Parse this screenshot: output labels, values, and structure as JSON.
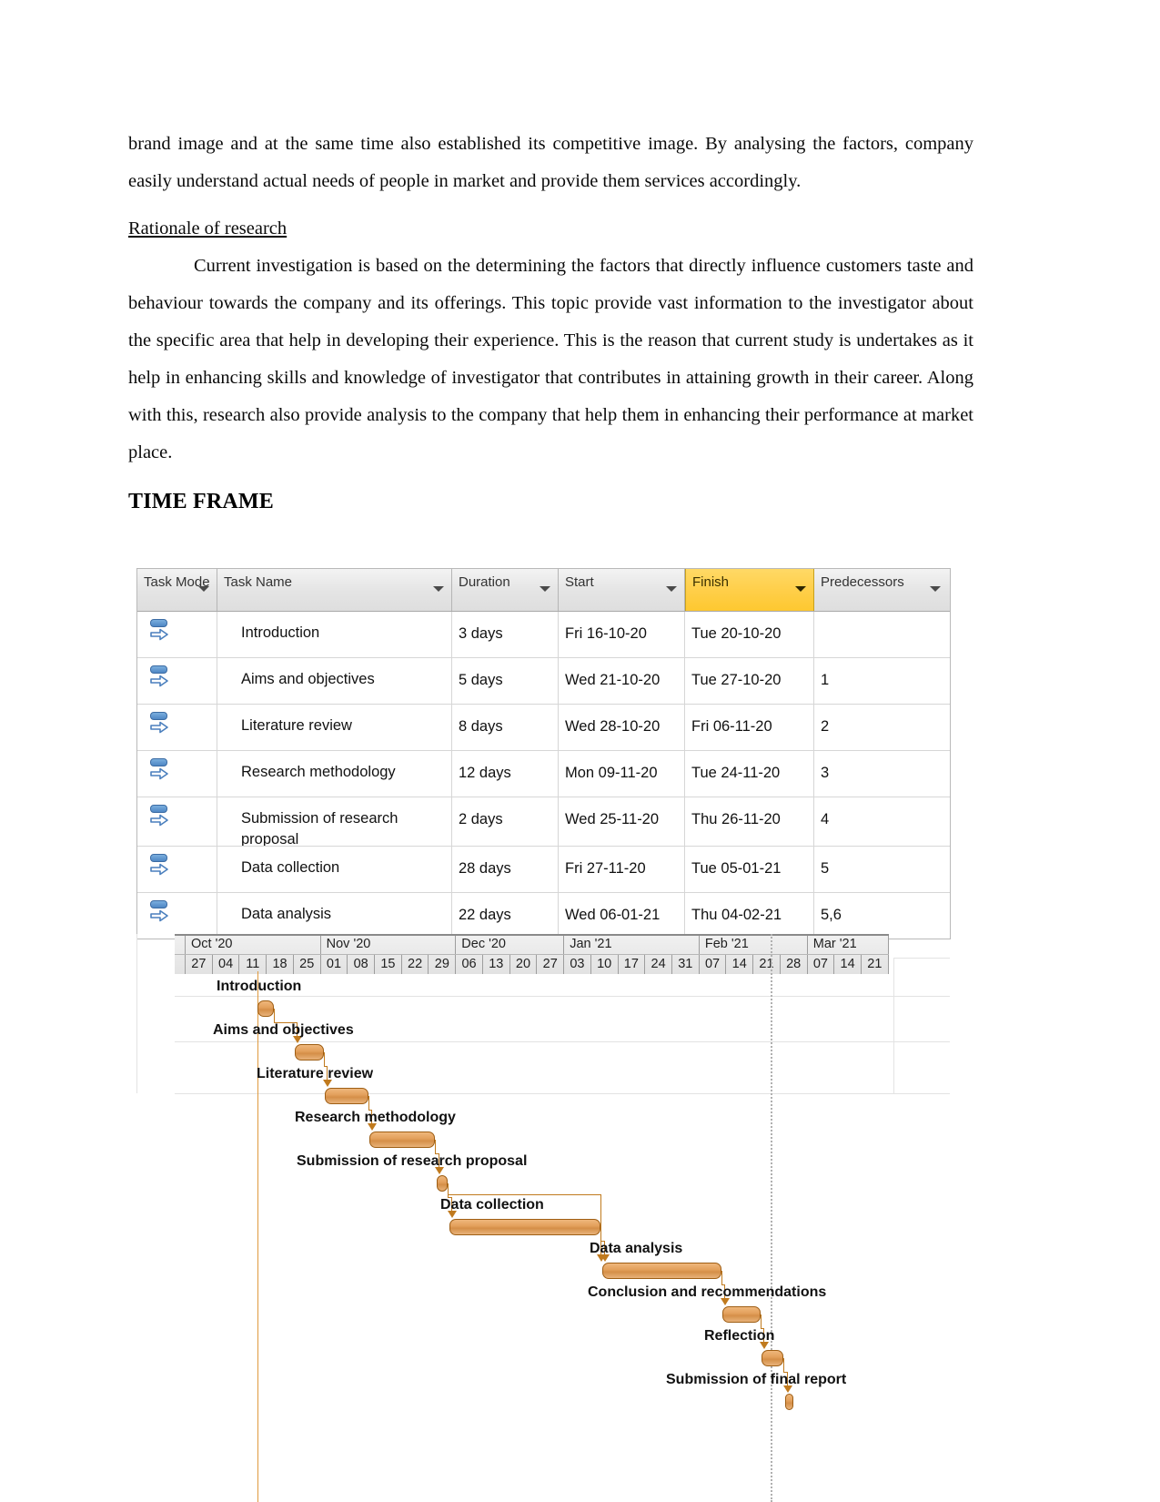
{
  "document": {
    "paragraph_1": "brand image and at the same time also established its competitive image. By analysing the factors, company easily understand actual needs of people in market and provide them services accordingly.",
    "heading_rationale": "Rationale of research",
    "paragraph_2": "Current investigation is based on the determining the factors that directly influence customers taste and behaviour towards the company and its offerings. This topic provide vast information to the investigator about the specific area that help in developing their experience. This is the reason that current study is undertakes as it help in enhancing skills and knowledge of investigator that contributes in attaining growth in their career. Along with this, research also provide analysis to the company that help them in enhancing their performance at market place.",
    "heading_time_frame": "TIME FRAME"
  },
  "project_table": {
    "headers": {
      "task_mode": "Task Mode",
      "task_name": "Task Name",
      "duration": "Duration",
      "start": "Start",
      "finish": "Finish",
      "predecessors": "Predecessors"
    },
    "highlight_color": "#ffcf4a",
    "rows": [
      {
        "mode_icon": "auto-schedule-icon",
        "name": "Introduction",
        "duration": "3 days",
        "start": "Fri 16-10-20",
        "finish": "Tue 20-10-20",
        "predecessors": ""
      },
      {
        "mode_icon": "auto-schedule-icon",
        "name": "Aims and objectives",
        "duration": "5 days",
        "start": "Wed 21-10-20",
        "finish": "Tue 27-10-20",
        "predecessors": "1"
      },
      {
        "mode_icon": "auto-schedule-icon",
        "name": "Literature review",
        "duration": "8 days",
        "start": "Wed 28-10-20",
        "finish": "Fri 06-11-20",
        "predecessors": "2"
      },
      {
        "mode_icon": "auto-schedule-icon",
        "name": "Research methodology",
        "duration": "12 days",
        "start": "Mon 09-11-20",
        "finish": "Tue 24-11-20",
        "predecessors": "3"
      },
      {
        "mode_icon": "auto-schedule-icon",
        "name": "Submission of research proposal",
        "duration": "2 days",
        "start": "Wed 25-11-20",
        "finish": "Thu 26-11-20",
        "predecessors": "4"
      },
      {
        "mode_icon": "auto-schedule-icon",
        "name": "Data collection",
        "duration": "28 days",
        "start": "Fri 27-11-20",
        "finish": "Tue 05-01-21",
        "predecessors": "5"
      },
      {
        "mode_icon": "auto-schedule-icon",
        "name": "Data analysis",
        "duration": "22 days",
        "start": "Wed 06-01-21",
        "finish": "Thu 04-02-21",
        "predecessors": "5,6"
      }
    ]
  },
  "chart_data": {
    "type": "bar",
    "title": "TIME FRAME",
    "subtype": "gantt",
    "xlabel": "",
    "ylabel": "",
    "grid": true,
    "legend": "none",
    "timescale": {
      "months": [
        "Oct '20",
        "Nov '20",
        "Dec '20",
        "Jan '21",
        "Feb '21",
        "Mar '21"
      ],
      "month_week_counts": [
        5,
        5,
        4,
        5,
        4,
        3
      ],
      "weeks": [
        "27",
        "04",
        "11",
        "18",
        "25",
        "01",
        "08",
        "15",
        "22",
        "29",
        "06",
        "13",
        "20",
        "27",
        "03",
        "10",
        "17",
        "24",
        "31",
        "07",
        "14",
        "21",
        "28",
        "07",
        "14",
        "21"
      ],
      "lead_partial_week": true
    },
    "categories": [
      "Introduction",
      "Aims and objectives",
      "Literature review",
      "Research methodology",
      "Submission of research proposal",
      "Data collection",
      "Data analysis",
      "Conclusion and recommendations",
      "Reflection",
      "Submission of final report"
    ],
    "tasks": [
      {
        "name": "Introduction",
        "duration_days": 3,
        "start": "Fri 16-10-20",
        "finish": "Tue 20-10-20",
        "predecessors": ""
      },
      {
        "name": "Aims and objectives",
        "duration_days": 5,
        "start": "Wed 21-10-20",
        "finish": "Tue 27-10-20",
        "predecessors": "1"
      },
      {
        "name": "Literature review",
        "duration_days": 8,
        "start": "Wed 28-10-20",
        "finish": "Fri 06-11-20",
        "predecessors": "2"
      },
      {
        "name": "Research methodology",
        "duration_days": 12,
        "start": "Mon 09-11-20",
        "finish": "Tue 24-11-20",
        "predecessors": "3"
      },
      {
        "name": "Submission of research proposal",
        "duration_days": 2,
        "start": "Wed 25-11-20",
        "finish": "Thu 26-11-20",
        "predecessors": "4"
      },
      {
        "name": "Data collection",
        "duration_days": 28,
        "start": "Fri 27-11-20",
        "finish": "Tue 05-01-21",
        "predecessors": "5"
      },
      {
        "name": "Data analysis",
        "duration_days": 22,
        "start": "Wed 06-01-21",
        "finish": "Thu 04-02-21",
        "predecessors": "5,6"
      },
      {
        "name": "Conclusion and recommendations",
        "duration_days": 7,
        "start": "",
        "finish": "",
        "predecessors": "7"
      },
      {
        "name": "Reflection",
        "duration_days": 4,
        "start": "",
        "finish": "",
        "predecessors": "8"
      },
      {
        "name": "Submission of final report",
        "duration_days": 1,
        "start": "",
        "finish": "",
        "predecessors": "9"
      }
    ],
    "bar_color": "#e3a05c",
    "bar_border_color": "#9e5e14",
    "link_color": "#c07a1e"
  }
}
